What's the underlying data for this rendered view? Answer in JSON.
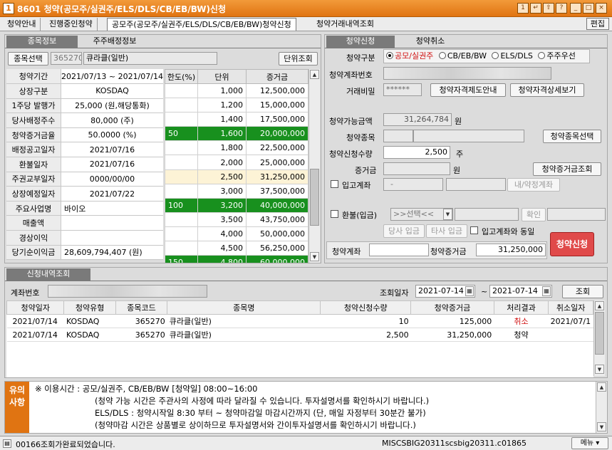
{
  "window": {
    "title": "8601 청약(공모주/실권주/ELS/DLS/CB/EB/BW)신청",
    "app_icon": "1",
    "buttons": [
      "1",
      "↵",
      "⇧",
      "?",
      "_",
      "□",
      "×"
    ]
  },
  "menu": {
    "tabs": [
      "청약안내",
      "진행중인청약",
      "공모주(공모주/실권주/ELS/DLS/CB/EB/BW)청약신청",
      "청약거래내역조회"
    ],
    "active": 2,
    "edit": "편집"
  },
  "left": {
    "tabs": [
      "종목정보",
      "주주배정정보"
    ],
    "select_btn": "종목선택",
    "code": "365270",
    "name": "큐라클(일반)",
    "unit_btn": "단위조회",
    "info": [
      {
        "k": "청약기간",
        "v": "2021/07/13 ~ 2021/07/14"
      },
      {
        "k": "상장구분",
        "v": "KOSDAQ"
      },
      {
        "k": "1주당 발행가",
        "v": "25,000 (원,해당통화)"
      },
      {
        "k": "당사배정주수",
        "v": "80,000 (주)"
      },
      {
        "k": "청약증거금율",
        "v": "50.0000 (%)"
      },
      {
        "k": "배정공고일자",
        "v": "2021/07/16"
      },
      {
        "k": "환불일자",
        "v": "2021/07/16"
      },
      {
        "k": "주권교부일자",
        "v": "0000/00/00"
      },
      {
        "k": "상장예정일자",
        "v": "2021/07/22"
      },
      {
        "k": "주요사업명",
        "v": "바이오"
      },
      {
        "k": "매출액",
        "v": ""
      },
      {
        "k": "경상이익",
        "v": ""
      },
      {
        "k": "당기순이익금",
        "v": "28,609,794,407 (원)"
      }
    ],
    "grid_headers": [
      "한도(%)",
      "단위",
      "증거금"
    ],
    "grid": [
      {
        "lim": "",
        "unit": "1,000",
        "dep": "12,500,000",
        "hl": ""
      },
      {
        "lim": "",
        "unit": "1,200",
        "dep": "15,000,000",
        "hl": ""
      },
      {
        "lim": "",
        "unit": "1,400",
        "dep": "17,500,000",
        "hl": ""
      },
      {
        "lim": "50",
        "unit": "1,600",
        "dep": "20,000,000",
        "hl": "g"
      },
      {
        "lim": "",
        "unit": "1,800",
        "dep": "22,500,000",
        "hl": ""
      },
      {
        "lim": "",
        "unit": "2,000",
        "dep": "25,000,000",
        "hl": ""
      },
      {
        "lim": "",
        "unit": "2,500",
        "dep": "31,250,000",
        "hl": "y"
      },
      {
        "lim": "",
        "unit": "3,000",
        "dep": "37,500,000",
        "hl": ""
      },
      {
        "lim": "100",
        "unit": "3,200",
        "dep": "40,000,000",
        "hl": "g"
      },
      {
        "lim": "",
        "unit": "3,500",
        "dep": "43,750,000",
        "hl": ""
      },
      {
        "lim": "",
        "unit": "4,000",
        "dep": "50,000,000",
        "hl": ""
      },
      {
        "lim": "",
        "unit": "4,500",
        "dep": "56,250,000",
        "hl": ""
      },
      {
        "lim": "150",
        "unit": "4,800",
        "dep": "60,000,000",
        "hl": "g"
      }
    ]
  },
  "right": {
    "tabs": [
      "청약신청",
      "청약취소"
    ],
    "type_label": "청약구분",
    "radios": [
      "공모/실권주",
      "CB/EB/BW",
      "ELS/DLS",
      "주주우선"
    ],
    "account_label": "청약계좌번호",
    "pw_label": "거래비밀",
    "pw": "******",
    "btn_guide": "청약자격제도안내",
    "btn_detail": "청약자격상세보기",
    "avail_label": "청약가능금액",
    "avail": "31,264,784",
    "won": "원",
    "item_label": "청약종목",
    "item_btn": "청약종목선택",
    "qty_label": "청약신청수량",
    "qty": "2,500",
    "ju": "주",
    "dep_label": "증거금",
    "dep_won": "원",
    "dep_btn": "청약증거금조회",
    "inacct_label": "입고계좌",
    "inacct_dash": "-",
    "inacct_btn": "내/약정계좌",
    "refund_label": "환불(입금)",
    "refund_sel": ">>선택<<",
    "confirm": "확인",
    "self_dep": "당사 입금",
    "other_dep": "타사 입금",
    "same_label": "입고계좌와 동일",
    "bot_acct_label": "청약계좌",
    "bot_dep_label": "청약증거금",
    "bot_dep": "31,250,000",
    "submit": "청약신청"
  },
  "history": {
    "tab": "신청내역조회",
    "acct_label": "계좌번호",
    "date_label": "조회일자",
    "from": "2021-07-14",
    "tilde": "~",
    "to": "2021-07-14",
    "query_btn": "조회",
    "headers": [
      "청약일자",
      "청약유형",
      "종목코드",
      "종목명",
      "청약신청수량",
      "청약증거금",
      "처리결과",
      "취소일자"
    ],
    "rows": [
      [
        "2021/07/14",
        "KOSDAQ",
        "365270",
        "큐라클(일반)",
        "10",
        "125,000",
        "취소",
        "2021/07/1"
      ],
      [
        "2021/07/14",
        "KOSDAQ",
        "365270",
        "큐라클(일반)",
        "2,500",
        "31,250,000",
        "청약",
        ""
      ]
    ]
  },
  "notice": {
    "label": "유의\n사항",
    "lines": [
      "※ 이용시간 : 공모/실권주, CB/EB/BW [청약일] 08:00~16:00",
      "(청약 가능 시간은 주관사의 사정에 따라 달라질 수 있습니다. 투자설명서를 확인하시기 바랍니다.)",
      "ELS/DLS : 청약시작일 8:30 부터 ~ 청약마감일 마감시간까지 (단, 매일 자정부터 30분간 불가)",
      "(청약마감 시간은 상품별로 상이하므로 투자설명서와 간이투자설명서를  확인하시기 바랍니다.)"
    ]
  },
  "status": {
    "msg": "00166조회가완료되었습니다.",
    "code": "MISCSBIG20311scsbig20311.c",
    "num": "01865",
    "menu": "메뉴"
  },
  "colors": {
    "title": "#e07412",
    "green": "#18901e",
    "red_btn": "#e04a4a",
    "cancel": "#d01010"
  }
}
